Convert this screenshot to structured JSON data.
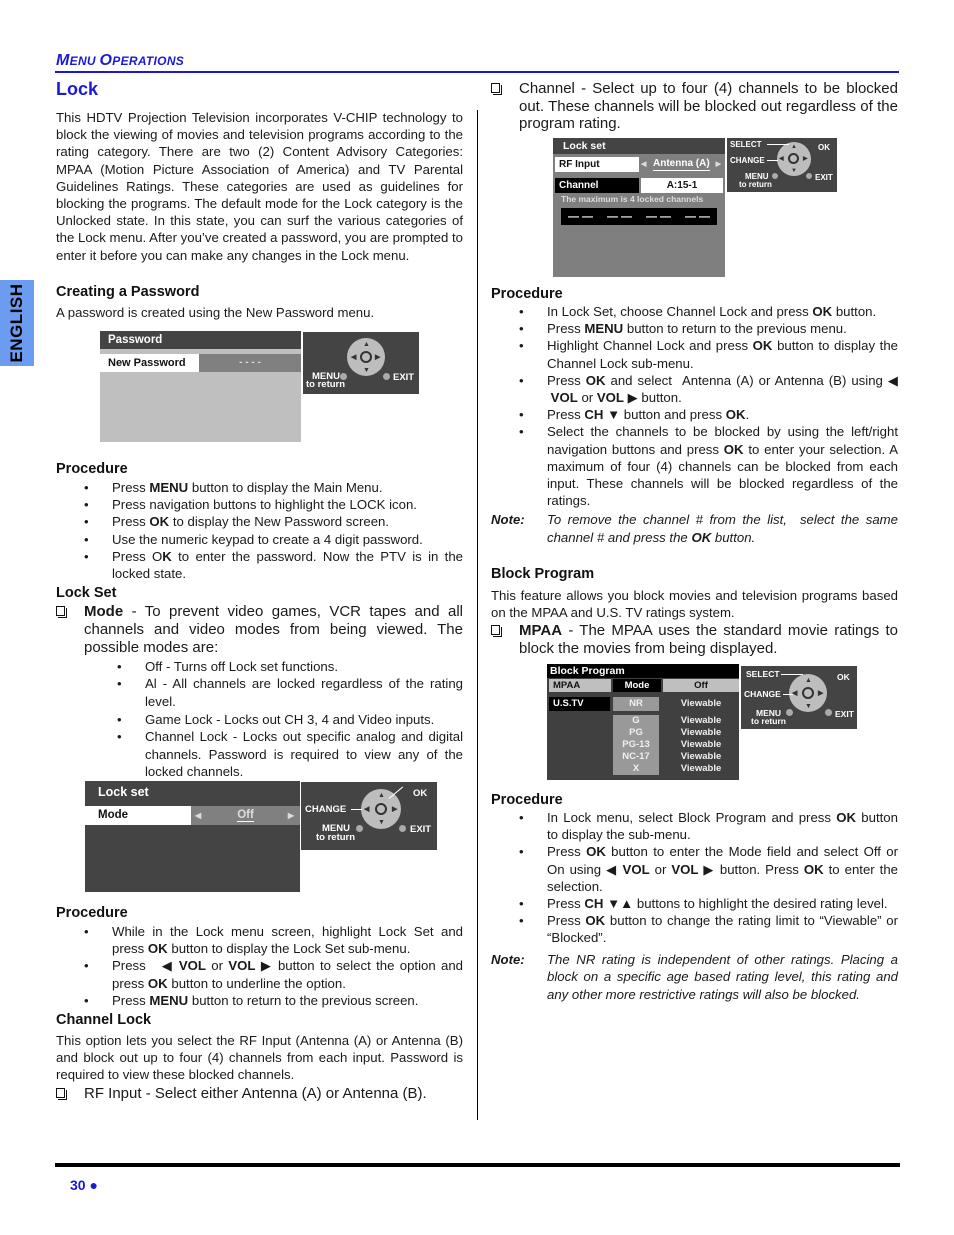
{
  "header": {
    "section_label_cap1": "M",
    "section_label_rest1": "ENU ",
    "section_label_cap2": "O",
    "section_label_rest2": "PERATIONS",
    "language_tab": "ENGLISH"
  },
  "footer": {
    "page_number": "30 ●"
  },
  "left": {
    "title": "Lock",
    "intro": "This HDTV Projection Television incorporates V-CHIP technology to block the viewing of movies and television programs according to the rating category. There are two (2) Content Advisory Categories: MPAA (Motion Picture Association of America) and TV Parental Guidelines Ratings. These categories are used as guidelines for blocking the programs. The default mode for the Lock category is the Unlocked state. In this state, you can surf the various categories of the Lock menu. After you’ve created a password, you are prompted to enter it before you can make any changes in the Lock menu.",
    "creating_password": {
      "heading": "Creating a Password",
      "text": "A password is created using the New Password menu."
    },
    "password_screen": {
      "header": "Password",
      "row_label": "New Password",
      "row_value": "- - - -",
      "menu_label": "MENU",
      "to_return": "to return",
      "exit_label": "EXIT"
    },
    "procedure1": {
      "heading": "Procedure",
      "items": [
        {
          "pre": "Press ",
          "bold": "MENU",
          "post": " button to display the Main Menu."
        },
        {
          "pre": "Press navigation buttons to highlight the LOCK icon.",
          "bold": "",
          "post": ""
        },
        {
          "pre": "Press ",
          "bold": "OK",
          "post": " to display the New Password screen."
        },
        {
          "pre": "Use the numeric keypad to create a 4 digit password.",
          "bold": "",
          "post": ""
        },
        {
          "pre": "Press O",
          "bold": "K",
          "post": " to enter the password. Now the PTV is in the locked state."
        }
      ]
    },
    "lock_set": {
      "heading": "Lock Set",
      "mode_bold": "Mode",
      "mode_text": " - To prevent video games, VCR tapes and all channels and video modes from being viewed. The possible modes are:",
      "modes": [
        "Off - Turns off Lock set functions.",
        "Al  - All channels are locked regardless of the rating level.",
        "Game Lock - Locks out CH 3, 4 and Video inputs.",
        "Channel Lock - Locks out specific analog and digital channels. Password is required to view any of the locked channels."
      ]
    },
    "lockset_screen": {
      "header": "Lock set",
      "row_label": "Mode",
      "row_value": "Off",
      "change_label": "CHANGE",
      "ok_label": "OK",
      "menu_label": "MENU",
      "to_return": "to return",
      "exit_label": "EXIT"
    },
    "procedure2": {
      "heading": "Procedure",
      "items": [
        {
          "html": "While in the Lock menu screen, highlight Lock Set and press <b>OK</b> button to display the Lock Set sub-menu."
        },
        {
          "html": "Press &nbsp;&nbsp;◀ <b>VOL</b> or <b>VOL</b> ▶ button to select the option and press <b>OK</b> button to underline the option."
        },
        {
          "html": "Press <b>MENU</b> button to return to the previous screen."
        }
      ]
    },
    "channel_lock": {
      "heading": "Channel Lock",
      "text": "This option lets you select the RF Input (Antenna (A) or Antenna (B) and block out up to four (4) channels from each input. Password is required to view these blocked channels.",
      "rf_item": "RF Input - Select either Antenna (A) or Antenna (B)."
    }
  },
  "right": {
    "channel_item": "Channel - Select up to four (4) channels to be blocked out. These channels will be blocked out regardless of the program rating.",
    "channel_screen": {
      "header": "Lock set",
      "rf_label": "RF Input",
      "rf_value": "Antenna (A)",
      "channel_label": "Channel",
      "channel_value": "A:15-1",
      "max_note": "The maximum is 4 locked channels",
      "slots": [
        "— —",
        "— —",
        "— —",
        "— —"
      ],
      "select_label": "SELECT",
      "change_label": "CHANGE",
      "ok_label": "OK",
      "menu_label": "MENU",
      "to_return": "to return",
      "exit_label": "EXIT"
    },
    "procedure3": {
      "heading": "Procedure",
      "items": [
        {
          "html": "In Lock Set, choose Channel Lock and press <b>OK</b> button."
        },
        {
          "html": "Press <b>MENU</b> button to return to the previous menu."
        },
        {
          "html": "Highlight Channel Lock and press <b>OK</b> button to display the Channel Lock sub-menu."
        },
        {
          "html": "Press <b>OK</b> and select &nbsp;Antenna (A) or Antenna (B) using ◀ &nbsp;<b>VOL</b> or <b>VOL</b> ▶ button."
        },
        {
          "html": "Press <b>CH ▼</b> button and press <b>OK</b>."
        },
        {
          "html": "Select the channels to be blocked by using the left/right navigation buttons and press <b>OK</b> to enter your selection. A maximum of four (4) channels can be blocked from each input. These channels will be blocked regardless of the ratings."
        }
      ],
      "note_label": "Note:",
      "note_html": "To remove the channel # from the list, &nbsp;select the same channel # and press the <b>OK</b> button."
    },
    "block_program": {
      "heading": "Block Program",
      "text": "This feature allows you block movies and television programs based on the MPAA and U.S. TV ratings system.",
      "mpaa_bold": "MPAA",
      "mpaa_text": " - The MPAA uses the standard movie ratings to block the movies from being displayed."
    },
    "block_screen": {
      "header": "Block Program",
      "col1": "MPAA",
      "mode_label": "Mode",
      "mode_value": "Off",
      "ustv": "U.S.TV",
      "ratings": [
        {
          "rating": "NR",
          "status": "Viewable"
        },
        {
          "rating": "G",
          "status": "Viewable"
        },
        {
          "rating": "PG",
          "status": "Viewable"
        },
        {
          "rating": "PG-13",
          "status": "Viewable"
        },
        {
          "rating": "NC-17",
          "status": "Viewable"
        },
        {
          "rating": "X",
          "status": "Viewable"
        }
      ],
      "select_label": "SELECT",
      "change_label": "CHANGE",
      "ok_label": "OK",
      "menu_label": "MENU",
      "to_return": "to return",
      "exit_label": "EXIT"
    },
    "procedure4": {
      "heading": "Procedure",
      "items": [
        {
          "html": "In Lock menu, select Block Program and press <b>OK</b> button to display the sub-menu."
        },
        {
          "html": "Press <b>OK</b> button to enter the Mode field and select Off or On using ◀ <b>VOL</b> or <b>VOL</b> ▶ button. Press <b>OK</b> to enter the selection."
        },
        {
          "html": "Press <b>CH ▼▲</b> buttons to highlight the desired rating level."
        },
        {
          "html": "Press <b>OK</b> button to change the rating limit to “Viewable” or “Blocked”."
        }
      ],
      "note_label": "Note:",
      "note_text": "The NR rating is independent of other ratings. Placing a block on a specific age based rating level, this rating and any other more restrictive ratings will also be blocked."
    }
  }
}
